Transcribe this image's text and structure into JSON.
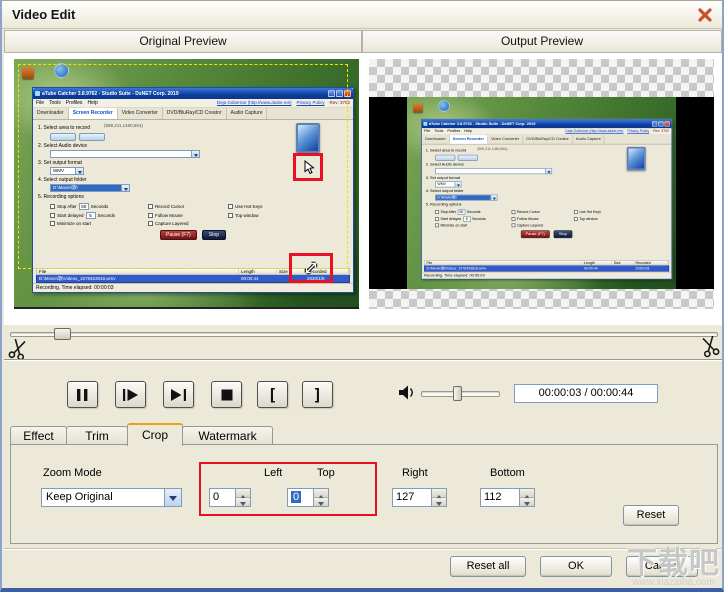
{
  "window": {
    "title": "Video Edit"
  },
  "preview_headers": {
    "original": "Original Preview",
    "output": "Output Preview"
  },
  "recorded_app": {
    "title": "aTube Catcher 3.8.9762 - Studio Suite - DsNET Corp. 2019",
    "menu": [
      "File",
      "Tools",
      "Profiles",
      "Help"
    ],
    "home_link": "Deja Gobernar (http://www.atube.me)",
    "privacy_link": "Privacy Policy",
    "revision": "Rev: 3702",
    "tabs": [
      "Downloader",
      "Screen Recorder",
      "Video Converter",
      "DVD/BluRay/CD Creator",
      "Audio Capture"
    ],
    "step1": "1. Select area to record",
    "coords": "(599,211,1460,864)",
    "step2": "2. Select Audio device",
    "step3": "3. Set output format",
    "format": "WMV",
    "step4": "4. Select output folder",
    "folder": "D:\\Movie\\歌\\",
    "step5": "5. Recording options",
    "options": [
      {
        "label": "Stop After",
        "num": "60",
        "suffix": "Seconds"
      },
      {
        "label": "Record Cursor"
      },
      {
        "label": "Use Hot Keys"
      },
      {
        "label": "Start delayed",
        "num": "5",
        "suffix": "Seconds"
      },
      {
        "label": "Follow Mouse"
      },
      {
        "label": "Top window"
      },
      {
        "label": "Minimize on start"
      },
      {
        "label": "Capture Layered"
      }
    ],
    "pause_button": "Pause (F7)",
    "stop_button": "Stop",
    "list_columns": [
      "File",
      "Length",
      "Size",
      "Recorded"
    ],
    "file_row": {
      "file": "D:\\Movie\\歌\\Videos_1578453818.wmv",
      "length": "00:00:44",
      "size": "",
      "recorded": "2020/1/8"
    },
    "status": "Recording, Time elapsed: 00:00:03"
  },
  "icons": {
    "close": "✕",
    "scissors": "✂",
    "pause": "❚❚",
    "play": "▶",
    "play_to_end": "▶|",
    "stop": "■",
    "mark_in": "[",
    "mark_out": "]",
    "speaker": "🔊"
  },
  "transport": {
    "time_display": "00:00:03 / 00:00:44"
  },
  "tabs": {
    "effect": "Effect",
    "trim": "Trim",
    "crop": "Crop",
    "watermark": "Watermark"
  },
  "crop_panel": {
    "zoom_mode_label": "Zoom Mode",
    "zoom_mode_value": "Keep Original",
    "left_label": "Left",
    "left_value": "0",
    "top_label": "Top",
    "top_value": "0",
    "right_label": "Right",
    "right_value": "127",
    "bottom_label": "Bottom",
    "bottom_value": "112",
    "reset_label": "Reset"
  },
  "footer": {
    "reset_all": "Reset all",
    "ok": "OK",
    "cancel": "Cancel"
  },
  "site_watermark": {
    "text": "下载吧",
    "url": "www.xiazaiba.com"
  }
}
